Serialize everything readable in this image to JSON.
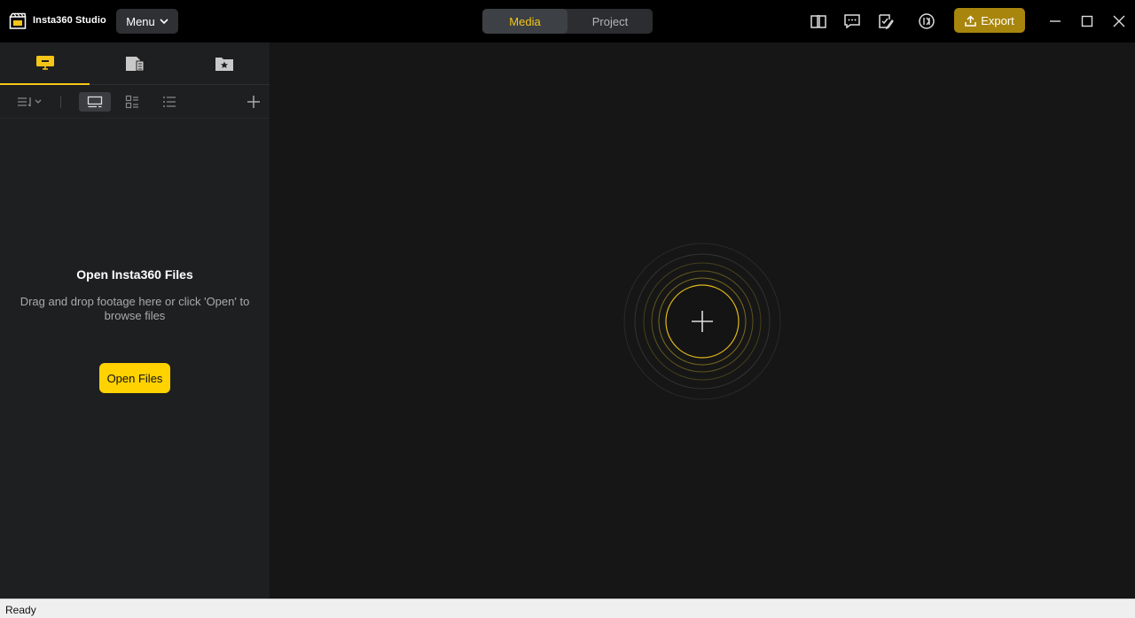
{
  "app": {
    "title": "Insta360 Studio"
  },
  "titlebar": {
    "menu_label": "Menu",
    "tabs": [
      {
        "label": "Media",
        "active": true
      },
      {
        "label": "Project",
        "active": false
      }
    ],
    "icons": [
      "book-icon",
      "feedback-icon",
      "checklist-icon",
      "firmware-icon"
    ],
    "export_label": "Export"
  },
  "sidebar": {
    "tabs": [
      "local-device-icon",
      "file-icon",
      "favorites-icon"
    ],
    "empty_state": {
      "title": "Open Insta360 Files",
      "description": "Drag and drop footage here or click 'Open' to browse files",
      "button_label": "Open Files"
    }
  },
  "status": {
    "text": "Ready"
  },
  "colors": {
    "accent": "#f5c518",
    "export_bg": "#a8860d",
    "button_bg": "#ffd200"
  }
}
